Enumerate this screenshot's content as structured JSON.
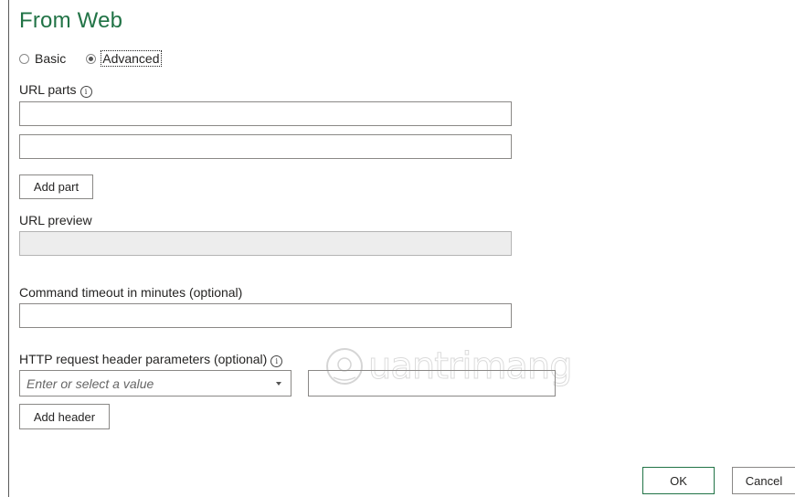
{
  "dialog": {
    "title": "From Web"
  },
  "mode": {
    "options": [
      {
        "label": "Basic",
        "selected": false
      },
      {
        "label": "Advanced",
        "selected": true
      }
    ]
  },
  "url_parts": {
    "label": "URL parts",
    "parts": [
      {
        "value": ""
      },
      {
        "value": ""
      }
    ],
    "add_part_label": "Add part"
  },
  "url_preview": {
    "label": "URL preview",
    "value": ""
  },
  "timeout": {
    "label": "Command timeout in minutes (optional)",
    "value": ""
  },
  "http_headers": {
    "label": "HTTP request header parameters (optional)",
    "name_placeholder": "Enter or select a value",
    "value": "",
    "add_header_label": "Add header"
  },
  "footer": {
    "ok_label": "OK",
    "cancel_label": "Cancel"
  },
  "watermark": {
    "text": "uantrimang"
  },
  "colors": {
    "title": "#217346",
    "primary_border": "#217346"
  },
  "icons": [
    "info-icon",
    "dropdown-caret-icon",
    "watermark-logo-icon"
  ]
}
